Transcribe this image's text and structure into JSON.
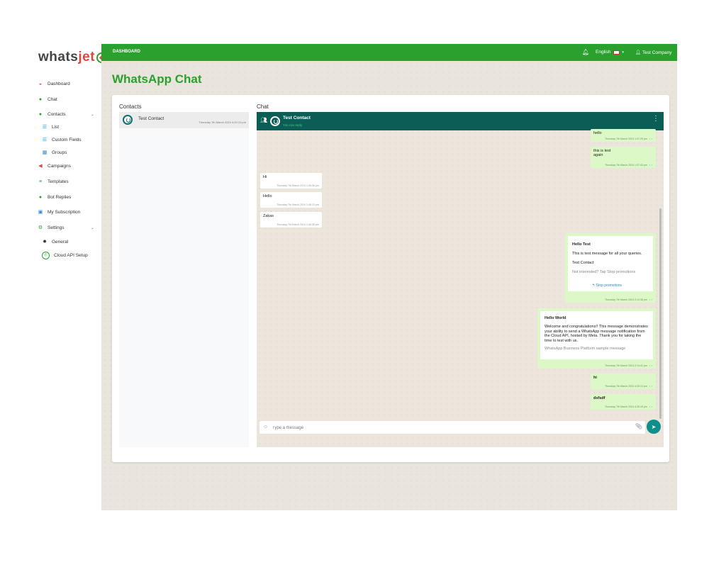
{
  "logo": {
    "part1": "whats",
    "part2": "jet"
  },
  "nav": {
    "dashboard": "Dashboard",
    "chat": "Chat",
    "contacts": "Contacts",
    "list": "List",
    "custom_fields": "Custom Fields",
    "groups": "Groups",
    "campaigns": "Campaigns",
    "templates": "Templates",
    "bot_replies": "Bot Replies",
    "my_subscription": "My Subscription",
    "settings": "Settings",
    "general": "General",
    "cloud_api_setup": "Cloud API Setup"
  },
  "topbar": {
    "breadcrumb": "DASHBOARD",
    "language": "English",
    "user": "Test Company"
  },
  "page": {
    "title": "WhatsApp Chat"
  },
  "contacts_panel": {
    "heading": "Contacts",
    "items": [
      {
        "name": "Test Contact",
        "time": "Thursday 7th March 2024 4:20:13 pm"
      }
    ]
  },
  "chat_panel": {
    "heading": "Chat",
    "contact_name": "Test Contact",
    "status": "You can reply",
    "input_placeholder": "Type a message"
  },
  "messages": [
    {
      "text": "hello",
      "time": "Thursday 7th March 2024 1:07:29 pm"
    },
    {
      "text": "this is test",
      "text2": "again",
      "time": "Thursday 7th March 2024 1:07:43 pm"
    },
    {
      "text": "Hi",
      "time": "Thursday 7th March 2024 1:08:36 pm"
    },
    {
      "text": "Hello",
      "time": "Thursday 7th March 2024 1:08:13 pm"
    },
    {
      "text": "Zakas",
      "time": "Thursday 7th March 2024 1:08:35 pm"
    },
    {
      "header": "Hello Test",
      "body": "This is test message for all your queries.",
      "body2": "Test Contact",
      "footer": "Not interested? Tap Stop promotions",
      "button": "Stop promotions",
      "time": "Thursday 7th March 2024 2:12:36 pm"
    },
    {
      "header": "Hello World",
      "body": "Welcome and congratulations!! This message demonstrates your ability to send a WhatsApp message notification from the Cloud API, hosted by Meta. Thank you for taking the time to test with us.",
      "footer": "WhatsApp Business Platform sample message",
      "time": "Thursday 7th March 2024 2:14:41 pm"
    },
    {
      "text": "hi",
      "time": "Thursday 7th March 2024 4:20:13 pm"
    },
    {
      "text": "dsfsdf",
      "time": "Thursday 7th March 2024 4:30:15 pm"
    }
  ],
  "colors": {
    "brand_green": "#2aa12f",
    "chat_header": "#0a5e55",
    "outgoing_bubble": "#dcf8c6",
    "send_button": "#0f8f8a"
  },
  "icons": [
    "dashboard-icon",
    "chat-icon",
    "contacts-icon",
    "list-icon",
    "custom-fields-icon",
    "groups-icon",
    "campaigns-icon",
    "templates-icon",
    "bot-replies-icon",
    "subscription-icon",
    "settings-icon",
    "gear-icon",
    "whatsapp-icon",
    "bell-icon",
    "flag-icon",
    "user-icon",
    "group-icon",
    "kebab-icon",
    "emoji-icon",
    "paperclip-icon",
    "send-icon",
    "reply-icon",
    "check-icon"
  ]
}
